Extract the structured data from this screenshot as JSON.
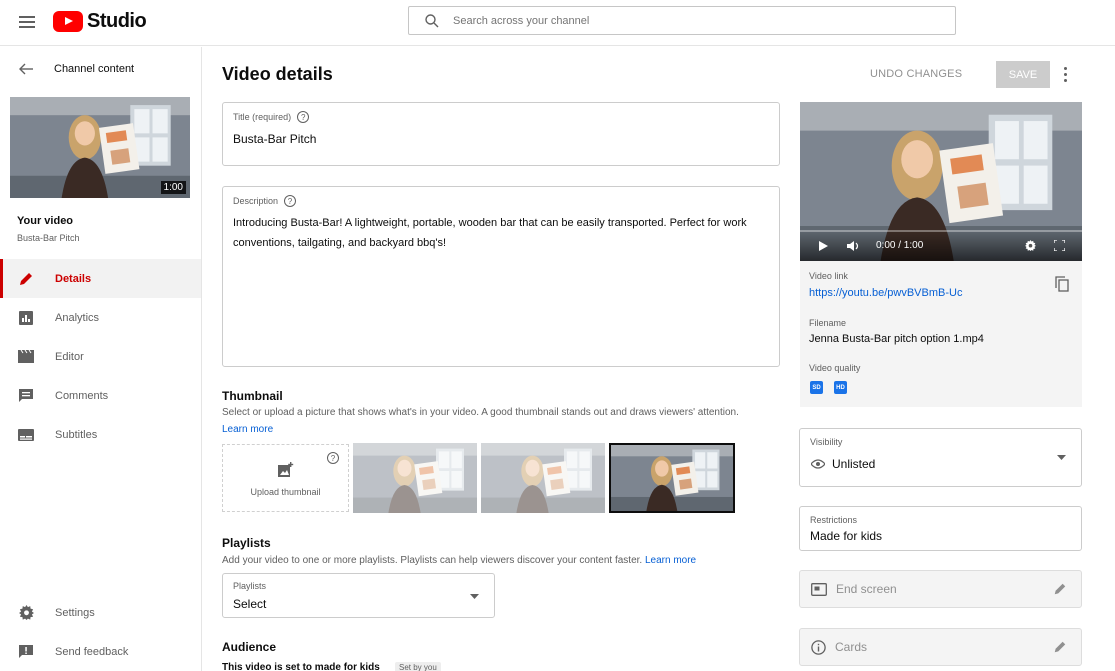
{
  "header": {
    "logo_text": "Studio",
    "search_placeholder": "Search across your channel"
  },
  "sidebar": {
    "back_label": "Channel content",
    "thumb_duration": "1:00",
    "your_video_label": "Your video",
    "video_name": "Busta-Bar Pitch",
    "items": [
      {
        "label": "Details",
        "icon": "pencil-icon",
        "active": true
      },
      {
        "label": "Analytics",
        "icon": "analytics-icon",
        "active": false
      },
      {
        "label": "Editor",
        "icon": "clapperboard-icon",
        "active": false
      },
      {
        "label": "Comments",
        "icon": "comment-icon",
        "active": false
      },
      {
        "label": "Subtitles",
        "icon": "subtitles-icon",
        "active": false
      }
    ],
    "bottom_items": [
      {
        "label": "Settings",
        "icon": "gear-icon"
      },
      {
        "label": "Send feedback",
        "icon": "feedback-icon"
      }
    ]
  },
  "main": {
    "title": "Video details",
    "undo_label": "UNDO CHANGES",
    "save_label": "SAVE",
    "title_field": {
      "label": "Title (required)",
      "value": "Busta-Bar Pitch"
    },
    "description_field": {
      "label": "Description",
      "value": "Introducing Busta-Bar! A lightweight, portable, wooden bar that can be easily transported. Perfect for work conventions, tailgating, and backyard bbq's!"
    },
    "thumbnail": {
      "heading": "Thumbnail",
      "description": "Select or upload a picture that shows what's in your video. A good thumbnail stands out and draws viewers' attention.",
      "learn_more": "Learn more",
      "upload_label": "Upload thumbnail"
    },
    "playlists": {
      "heading": "Playlists",
      "description": "Add your video to one or more playlists. Playlists can help viewers discover your content faster.",
      "learn_more": "Learn more",
      "select_label": "Playlists",
      "select_value": "Select"
    },
    "audience": {
      "heading": "Audience",
      "text": "This video is set to made for kids",
      "badge": "Set by you"
    }
  },
  "right": {
    "player_time": "0:00 / 1:00",
    "video_link_label": "Video link",
    "video_link": "https://youtu.be/pwvBVBmB-Uc",
    "filename_label": "Filename",
    "filename": "Jenna Busta-Bar pitch option 1.mp4",
    "quality_label": "Video quality",
    "quality_badges": [
      "SD",
      "HD"
    ],
    "visibility_label": "Visibility",
    "visibility_value": "Unlisted",
    "restrictions_label": "Restrictions",
    "restrictions_value": "Made for kids",
    "end_screen_label": "End screen",
    "cards_label": "Cards"
  }
}
